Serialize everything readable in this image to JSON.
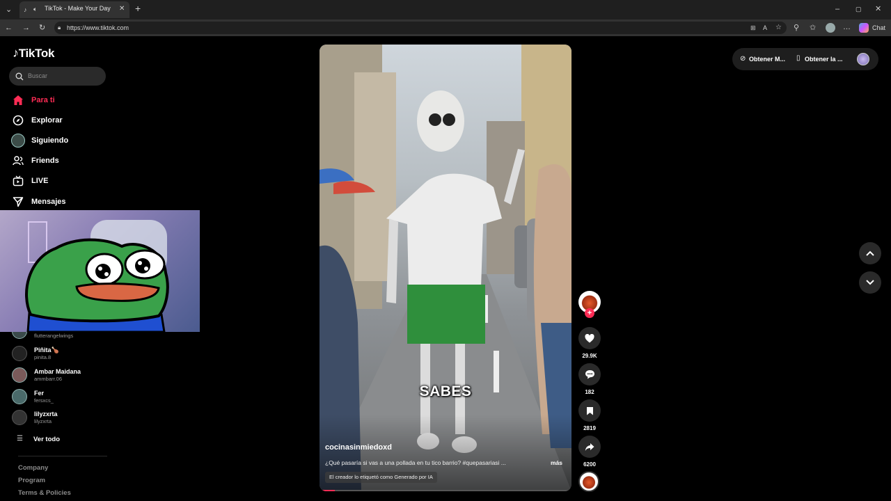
{
  "browser": {
    "tab_title": "TikTok - Make Your Day",
    "url": "https://www.tiktok.com",
    "chat_label": "Chat"
  },
  "sidebar": {
    "logo": "TikTok",
    "search_placeholder": "Buscar",
    "nav": [
      {
        "label": "Para ti",
        "icon": "home-icon",
        "active": true
      },
      {
        "label": "Explorar",
        "icon": "compass-icon"
      },
      {
        "label": "Siguiendo",
        "icon": "avatar-icon"
      },
      {
        "label": "Friends",
        "icon": "friends-icon"
      },
      {
        "label": "LIVE",
        "icon": "live-icon"
      },
      {
        "label": "Mensajes",
        "icon": "send-icon"
      }
    ],
    "following": [
      {
        "name": "",
        "user": "flutterangelwings"
      },
      {
        "name": "Piñita🍗",
        "user": "pinita.8"
      },
      {
        "name": "Ambar Maidana",
        "user": "ammbarr.06"
      },
      {
        "name": "Fer",
        "user": "fersxcs_"
      },
      {
        "name": "lilyzxrta",
        "user": "lilyzxrta"
      }
    ],
    "see_all": "Ver todo",
    "footer": [
      "Company",
      "Program",
      "Terms & Policies"
    ]
  },
  "video": {
    "caption": "SABES",
    "author": "cocinasinmiedoxd",
    "description": "¿Qué pasaría si vas a una pollada en tu tico barrio? #quepasariasi ...",
    "more": "más",
    "ai_label": "El creador lo etiquetó como Generado por IA"
  },
  "actions": {
    "likes": "29.9K",
    "comments": "182",
    "saves": "2819",
    "shares": "6200"
  },
  "topright": {
    "get_coins": "Obtener M...",
    "get_app": "Obtener la ..."
  },
  "colors": {
    "accent": "#fe2c55",
    "background": "#000000"
  }
}
